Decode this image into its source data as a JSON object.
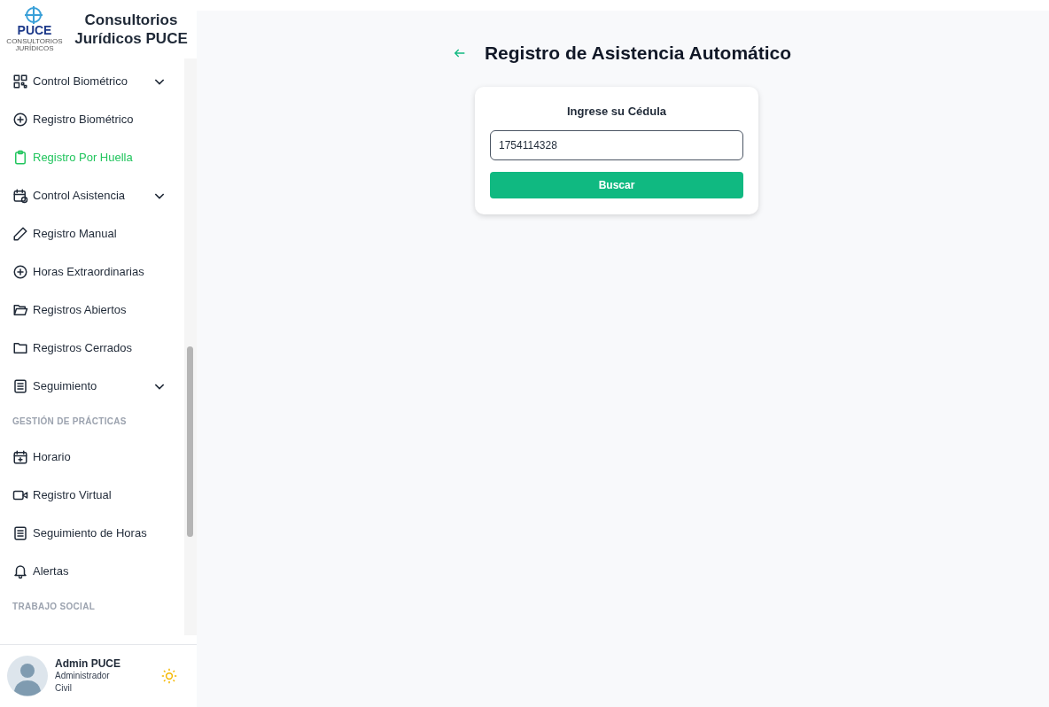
{
  "brand": {
    "logo_text": "PUCE",
    "logo_subtext": "CONSULTORIOS JURÍDICOS",
    "title": "Consultorios Jurídicos PUCE"
  },
  "sidebar": {
    "items": [
      {
        "kind": "group",
        "label": "Control Biométrico",
        "expanded": true
      },
      {
        "kind": "link",
        "label": "Registro Biométrico",
        "selected": false
      },
      {
        "kind": "link",
        "label": "Registro Por Huella",
        "selected": true
      },
      {
        "kind": "group",
        "label": "Control Asistencia",
        "expanded": true
      },
      {
        "kind": "link",
        "label": "Registro Manual",
        "selected": false
      },
      {
        "kind": "link",
        "label": "Horas Extraordinarias",
        "selected": false
      },
      {
        "kind": "link",
        "label": "Registros Abiertos",
        "selected": false
      },
      {
        "kind": "link",
        "label": "Registros Cerrados",
        "selected": false
      },
      {
        "kind": "group",
        "label": "Seguimiento",
        "expanded": true
      },
      {
        "kind": "section",
        "label": "GESTIÓN DE PRÁCTICAS"
      },
      {
        "kind": "link",
        "label": "Horario",
        "selected": false
      },
      {
        "kind": "link",
        "label": "Registro Virtual",
        "selected": false
      },
      {
        "kind": "link",
        "label": "Seguimiento de Horas",
        "selected": false
      },
      {
        "kind": "link",
        "label": "Alertas",
        "selected": false
      },
      {
        "kind": "section",
        "label": "TRABAJO SOCIAL"
      }
    ]
  },
  "user": {
    "name": "Admin PUCE",
    "role": "Administrador",
    "area": "Civil"
  },
  "page": {
    "title": "Registro de Asistencia Automático"
  },
  "form": {
    "label": "Ingrese su Cédula",
    "value": "1754114328",
    "button": "Buscar"
  }
}
